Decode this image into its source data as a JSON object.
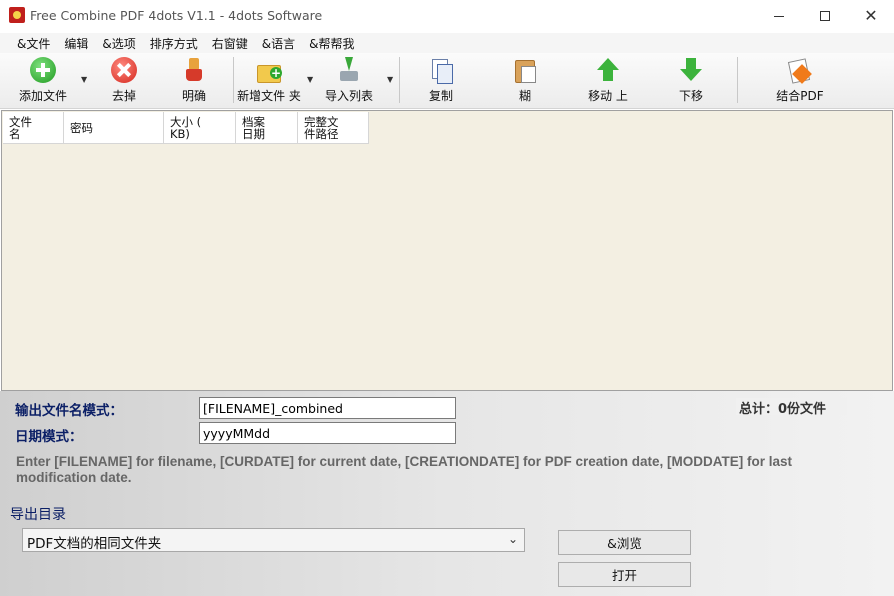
{
  "window": {
    "title": "Free Combine PDF 4dots V1.1 - 4dots Software"
  },
  "menu": [
    "&文件",
    "编辑",
    "&选项",
    "排序方式",
    "右窗键",
    "&语言",
    "&帮帮我"
  ],
  "toolbar": {
    "add_files": "添加文件",
    "remove": "去掉",
    "clear": "明确",
    "add_folder": "新增文件 夹",
    "import_list": "导入列表",
    "copy": "复制",
    "paste": "糊",
    "move_up": "移动 上",
    "move_down": "下移",
    "combine": "结合PDF"
  },
  "table": {
    "columns": [
      "文件\n名",
      "密码",
      "大小 (\nKB)",
      "档案\n日期",
      "完整文\n件路径"
    ]
  },
  "output": {
    "filename_label": "输出文件名模式：",
    "filename_value": "[FILENAME]_combined",
    "date_label": "日期模式：",
    "date_value": "yyyyMMdd",
    "total": "总计：0份文件",
    "hint": "Enter [FILENAME] for filename, [CURDATE] for current date, [CREATIONDATE] for PDF creation date, [MODDATE] for last modification date.",
    "export_dir_label": "导出目录",
    "export_dir_value": "PDF文档的相同文件夹",
    "browse": "&浏览",
    "open": "打开"
  },
  "icons": {
    "add": "plus-circle-icon",
    "remove": "x-circle-icon",
    "clear": "broom-icon",
    "add_folder": "folder-plus-icon",
    "import": "import-icon",
    "copy": "copy-icon",
    "paste": "paste-icon",
    "up": "arrow-up-icon",
    "down": "arrow-down-icon",
    "combine": "combine-pdf-icon"
  }
}
